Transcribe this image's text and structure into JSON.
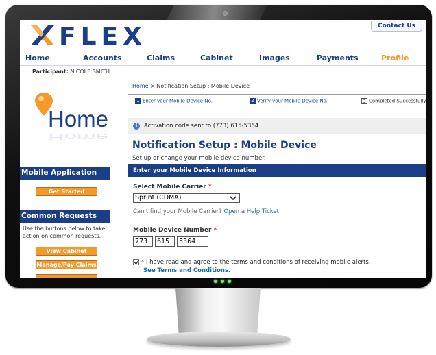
{
  "header": {
    "logo_text": "FLEX",
    "contact_us": "Contact Us"
  },
  "nav": {
    "items": [
      "Home",
      "Accounts",
      "Claims",
      "Cabinet",
      "Images",
      "Payments",
      "Profile"
    ],
    "active": "Profile"
  },
  "participant": {
    "label": "Participant:",
    "name": "NICOLE SMITH"
  },
  "home_graphic_text": "Home",
  "sidebar": {
    "mobile_app": {
      "heading": "Mobile Application",
      "button": "Get Started"
    },
    "common_requests": {
      "heading": "Common Requests",
      "description": "Use the buttons below to take action on common requests.",
      "buttons": [
        "View Cabinet",
        "Manage/Pay Claims",
        ""
      ]
    }
  },
  "breadcrumb": {
    "home": "Home",
    "sep": ">",
    "trail": "Notification Setup : Mobile Device"
  },
  "steps": [
    {
      "num": "1",
      "label": "Enter your Mobile Device No.",
      "state": "active"
    },
    {
      "num": "2",
      "label": "Verify your Mobile Device No.",
      "state": "active"
    },
    {
      "num": "3",
      "label": "Completed Successfully",
      "state": "inactive"
    }
  ],
  "alert": {
    "icon": "info-icon",
    "text": "Activation code sent to (773) 615-5364"
  },
  "page": {
    "title": "Notification Setup : Mobile Device",
    "subtitle": "Set up or change your mobile device number."
  },
  "form": {
    "section_heading": "Enter your Mobile Device Information",
    "carrier_label": "Select Mobile Carrier",
    "required_mark": "*",
    "carrier_value": "Sprint (CDMA)",
    "help_text": "Can't find your Mobile Carrier?",
    "help_link": "Open a Help Ticket",
    "number_label": "Mobile Device Number",
    "number_parts": [
      "773",
      "615",
      "5364"
    ],
    "terms_checked": true,
    "terms_text": "I have read and agree to the terms and conditions of receiving mobile alerts.",
    "terms_link": "See Terms and Conditions."
  },
  "colors": {
    "brand_blue": "#1b3f87",
    "accent_orange": "#f39a2a",
    "required_red": "#d9232d"
  }
}
